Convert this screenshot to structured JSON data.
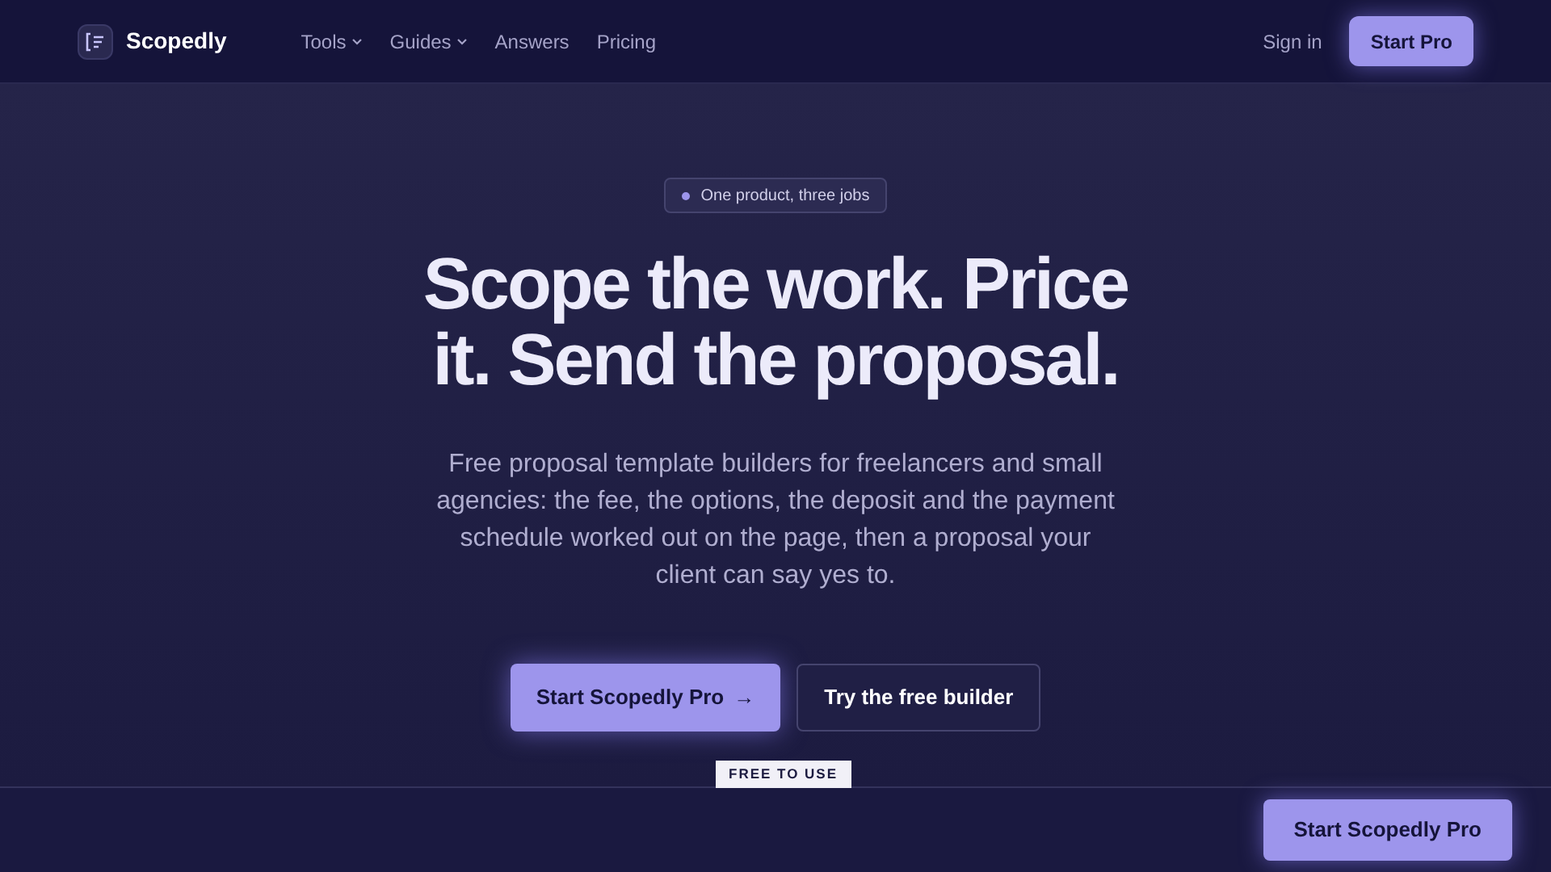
{
  "header": {
    "brand": "Scopedly",
    "nav": [
      {
        "label": "Tools",
        "dropdown": true
      },
      {
        "label": "Guides",
        "dropdown": true
      },
      {
        "label": "Answers",
        "dropdown": false
      },
      {
        "label": "Pricing",
        "dropdown": false
      }
    ],
    "sign_in": "Sign in",
    "cta": "Start Pro"
  },
  "hero": {
    "badge": "One product, three jobs",
    "title": "Scope the work. Price it. Send the proposal.",
    "text": "Free proposal template builders for freelancers and small agencies: the fee, the options, the deposit and the payment schedule worked out on the page, then a proposal your client can say yes to.",
    "primary": {
      "label": "Start Scopedly Pro",
      "icon": "→"
    },
    "secondary": "Try the free builder"
  },
  "sticky_bar": {
    "tag": "FREE TO USE",
    "button": "Start Scopedly Pro"
  }
}
